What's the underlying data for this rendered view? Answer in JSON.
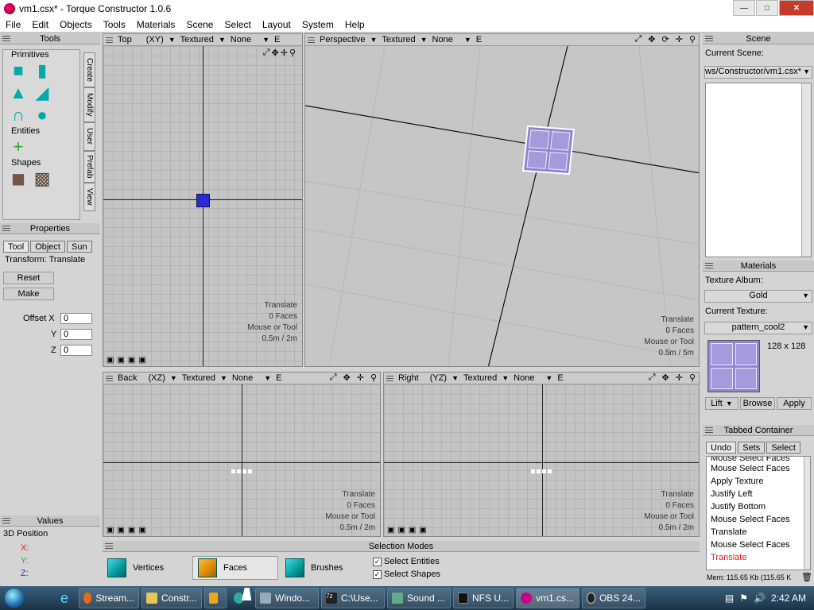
{
  "window": {
    "title": "vm1.csx* - Torque Constructor 1.0.6"
  },
  "menu": [
    "File",
    "Edit",
    "Objects",
    "Tools",
    "Materials",
    "Scene",
    "Select",
    "Layout",
    "System",
    "Help"
  ],
  "tools_panel": {
    "title": "Tools",
    "primitives_label": "Primitives",
    "entities_label": "Entities",
    "shapes_label": "Shapes",
    "side_tabs": [
      "Create",
      "Modify",
      "User",
      "Prefab",
      "View"
    ]
  },
  "properties_panel": {
    "title": "Properties",
    "tabs": [
      "Tool",
      "Object",
      "Sun"
    ],
    "transform_label": "Transform: Translate",
    "reset_label": "Reset",
    "make_label": "Make",
    "offset_x_label": "Offset X",
    "y_label": "Y",
    "z_label": "Z",
    "offset_x": "0",
    "offset_y": "0",
    "offset_z": "0"
  },
  "values_panel": {
    "title": "Values",
    "position_label": "3D Position",
    "x_label": "X:",
    "y_label": "Y:",
    "z_label": "Z:"
  },
  "viewports": {
    "top": {
      "name": "Top",
      "axis": "(XY)",
      "mode": "Textured",
      "filter": "None",
      "e": "E",
      "status": [
        "Translate",
        "0 Faces",
        "Mouse or Tool",
        "0.5m / 2m"
      ]
    },
    "persp": {
      "name": "Perspective",
      "mode": "Textured",
      "filter": "None",
      "e": "E",
      "status": [
        "Translate",
        "0 Faces",
        "Mouse or Tool",
        "0.5m / 5m"
      ]
    },
    "back": {
      "name": "Back",
      "axis": "(XZ)",
      "mode": "Textured",
      "filter": "None",
      "e": "E",
      "status": [
        "Translate",
        "0 Faces",
        "Mouse or Tool",
        "0.5m / 2m"
      ]
    },
    "right": {
      "name": "Right",
      "axis": "(YZ)",
      "mode": "Textured",
      "filter": "None",
      "e": "E",
      "status": [
        "Translate",
        "0 Faces",
        "Mouse or Tool",
        "0.5m / 2m"
      ]
    }
  },
  "selection_modes": {
    "title": "Selection Modes",
    "vertices": "Vertices",
    "faces": "Faces",
    "brushes": "Brushes",
    "select_entities": "Select Entities",
    "select_shapes": "Select Shapes"
  },
  "scene_panel": {
    "title": "Scene",
    "current_scene_label": "Current Scene:",
    "current_scene_value": "ws/Constructor/vm1.csx*"
  },
  "materials_panel": {
    "title": "Materials",
    "texture_album_label": "Texture Album:",
    "texture_album_value": "Gold",
    "current_texture_label": "Current Texture:",
    "current_texture_value": "pattern_cool2",
    "texture_size": "128 x 128",
    "lift_label": "Lift",
    "browse_label": "Browse",
    "apply_label": "Apply"
  },
  "tabbed_container": {
    "title": "Tabbed Container",
    "tabs": [
      "Undo",
      "Sets",
      "Select"
    ],
    "items": [
      "Mouse Select Faces",
      "Mouse Select Faces",
      "Apply Texture",
      "Justify Left",
      "Justify Bottom",
      "Mouse Select Faces",
      "Translate",
      "Mouse Select Faces",
      "Translate"
    ],
    "mem": "Mem: 115.65 Kb (115.65 K"
  },
  "taskbar": {
    "items": [
      "Stream...",
      "Constr...",
      "",
      "Windo...",
      "C:\\Use...",
      "Sound ...",
      "NFS U...",
      "vm1.cs...",
      "OBS 24..."
    ],
    "clock": "2:42 AM"
  },
  "colors": {
    "accent_red": "#e21b1b",
    "brush_blue": "#2a2ad6",
    "texture_purple": "#8f86cf"
  }
}
